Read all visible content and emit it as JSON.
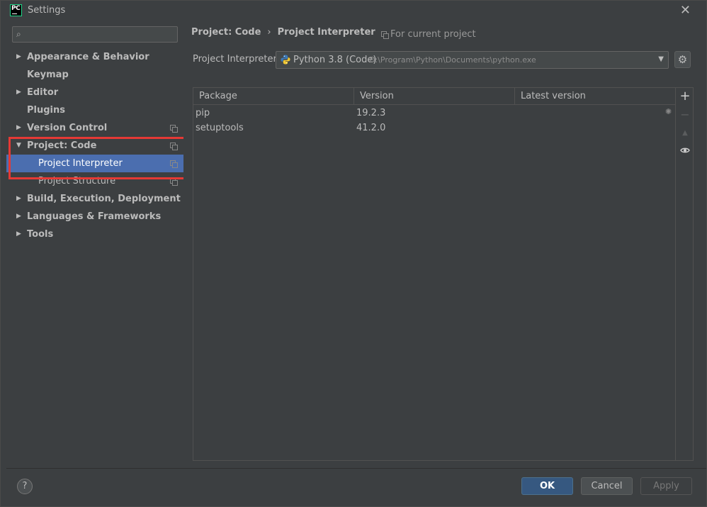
{
  "window": {
    "title": "Settings",
    "app_logo_text": "PC",
    "close_glyph": "✕"
  },
  "sidebar": {
    "search": {
      "placeholder": "",
      "value": ""
    },
    "items": [
      {
        "label": "Appearance & Behavior",
        "expandable": true,
        "expanded": false
      },
      {
        "label": "Keymap",
        "expandable": false
      },
      {
        "label": "Editor",
        "expandable": true,
        "expanded": false
      },
      {
        "label": "Plugins",
        "expandable": false
      },
      {
        "label": "Version Control",
        "expandable": true,
        "expanded": false,
        "project_icon": true
      },
      {
        "label": "Project: Code",
        "expandable": true,
        "expanded": true,
        "project_icon": true
      },
      {
        "label": "Project Interpreter",
        "child": true,
        "selected": true,
        "project_icon": true
      },
      {
        "label": "Project Structure",
        "child": true,
        "project_icon": true
      },
      {
        "label": "Build, Execution, Deployment",
        "expandable": true,
        "expanded": false
      },
      {
        "label": "Languages & Frameworks",
        "expandable": true,
        "expanded": false
      },
      {
        "label": "Tools",
        "expandable": true,
        "expanded": false
      }
    ]
  },
  "breadcrumb": {
    "parent": "Project: Code",
    "separator": "›",
    "current": "Project Interpreter"
  },
  "scope_note": "For current project",
  "interpreter": {
    "label": "Project Interpreter:",
    "name": "Python 3.8 (Code)",
    "path": "D:\\Program\\Python\\Documents\\python.exe"
  },
  "packages": {
    "columns": [
      "Package",
      "Version",
      "Latest version"
    ],
    "rows": [
      {
        "package": "pip",
        "version": "19.2.3",
        "latest": ""
      },
      {
        "package": "setuptools",
        "version": "41.2.0",
        "latest": ""
      }
    ]
  },
  "toolbar": {
    "add": "+",
    "remove": "−",
    "upgrade": "▲",
    "show": "👁"
  },
  "footer": {
    "help": "?",
    "ok": "OK",
    "cancel": "Cancel",
    "apply": "Apply"
  },
  "colors": {
    "selection": "#4b6eaf",
    "highlight_border": "#e53935",
    "primary_button": "#365880",
    "background": "#3c3f41"
  }
}
